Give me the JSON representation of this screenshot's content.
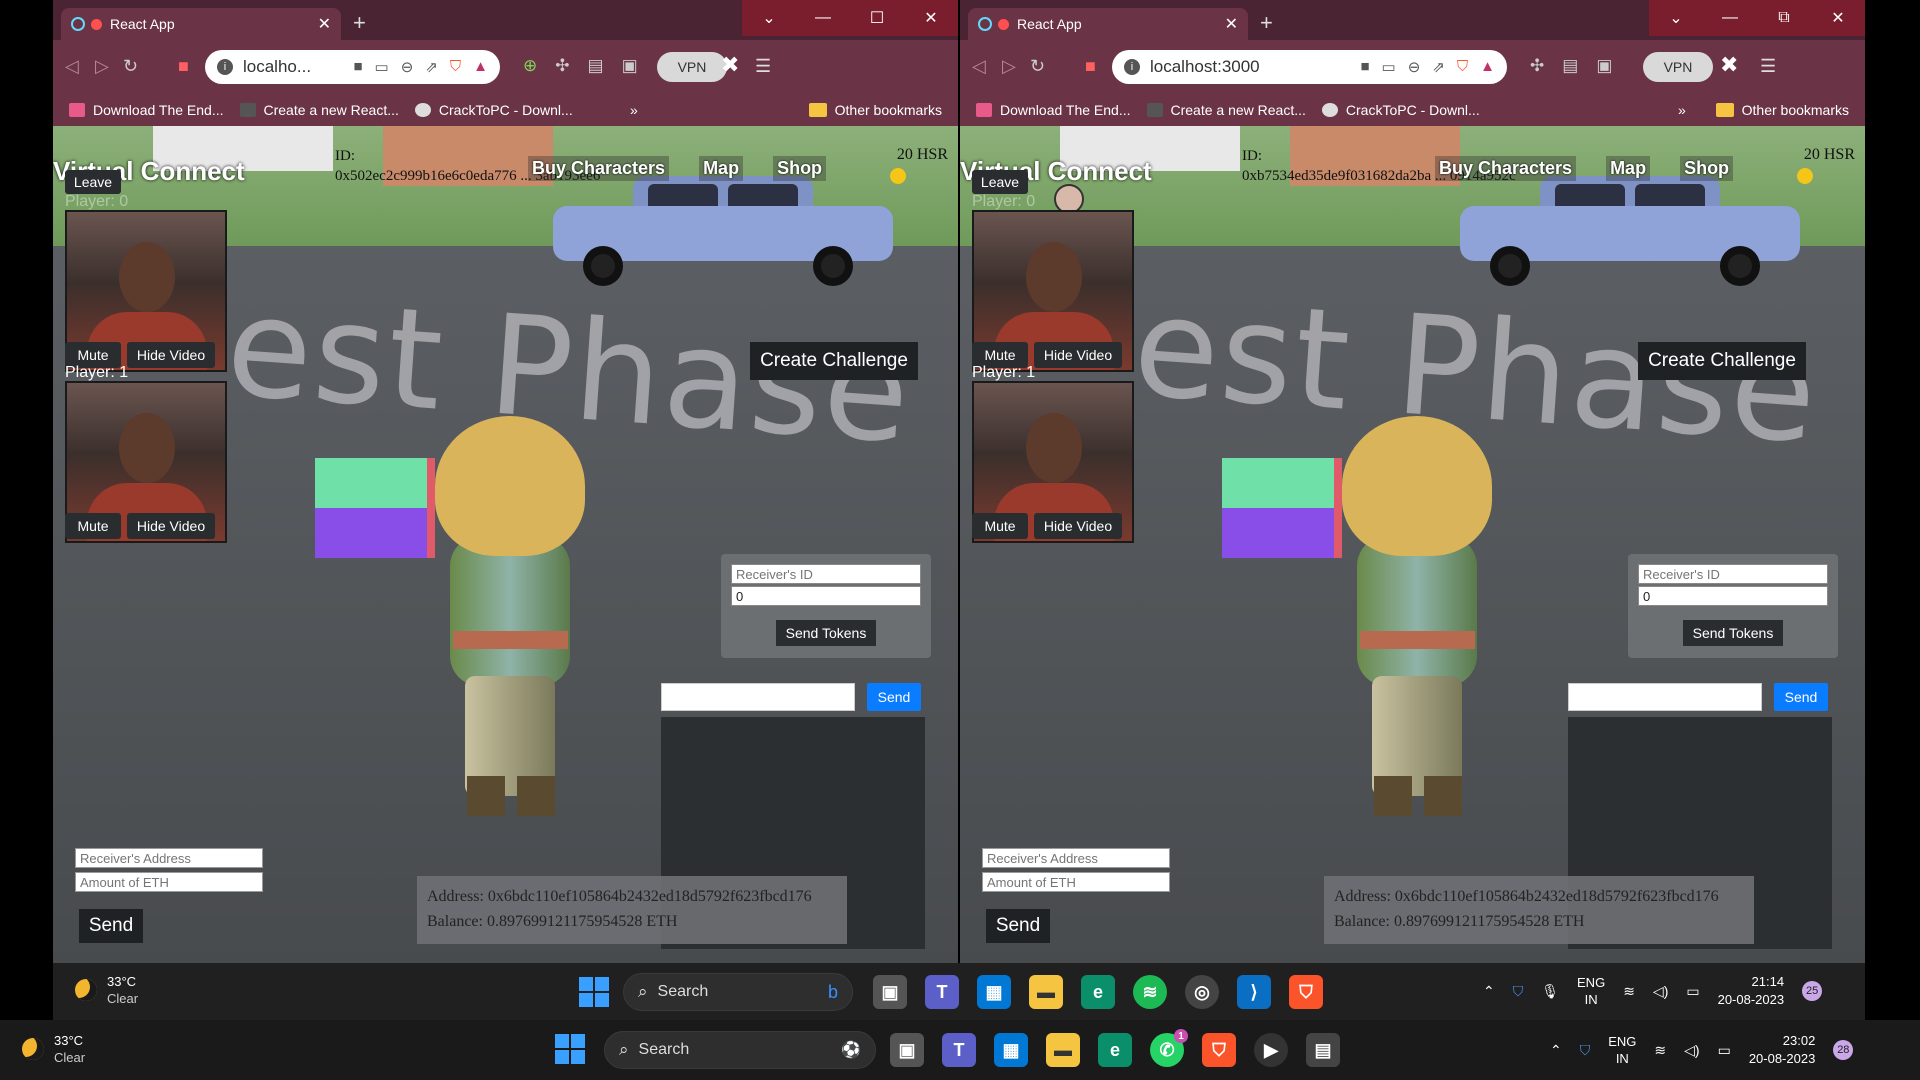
{
  "browser_left": {
    "tab_title": "React App",
    "url": "localho...",
    "vpn_label": "VPN",
    "bookmarks": [
      "Download The End...",
      "Create a new React...",
      "CrackToPC - Downl..."
    ],
    "other_bookmarks": "Other bookmarks",
    "app": {
      "title": "Virtual Connect",
      "id_label": "ID:",
      "id_value": "0x502ec2c999b16e6c0eda776 ... 3ab193ee6",
      "hsr": "20 HSR",
      "nav": [
        "Buy Characters",
        "Map",
        "Shop"
      ],
      "leave": "Leave",
      "player0": "Player: 0",
      "player1": "Player: 1",
      "mute": "Mute",
      "hide_video": "Hide Video",
      "watermark": "est Phase",
      "create_challenge": "Create Challenge",
      "receiver_id_placeholder": "Receiver's ID",
      "amount_value": "0",
      "send_tokens": "Send Tokens",
      "chat_send": "Send",
      "receiver_address_placeholder": "Receiver's Address",
      "amount_eth_placeholder": "Amount of ETH",
      "eth_send": "Send",
      "address": "Address: 0x6bdc110ef105864b2432ed18d5792f623fbcd176",
      "balance": "Balance: 0.897699121175954528 ETH"
    }
  },
  "browser_right": {
    "tab_title": "React App",
    "url": "localhost:3000",
    "vpn_label": "VPN",
    "bookmarks": [
      "Download The End...",
      "Create a new React...",
      "CrackToPC - Downl..."
    ],
    "other_bookmarks": "Other bookmarks",
    "app": {
      "title": "Virtual Connect",
      "id_label": "ID:",
      "id_value": "0xb7534ed35de9f031682da2ba ... 0914a952c",
      "hsr": "20 HSR",
      "nav": [
        "Buy Characters",
        "Map",
        "Shop"
      ],
      "leave": "Leave",
      "player0": "Player: 0",
      "player1": "Player: 1",
      "mute": "Mute",
      "hide_video": "Hide Video",
      "watermark": "est Phase",
      "create_challenge": "Create Challenge",
      "receiver_id_placeholder": "Receiver's ID",
      "amount_value": "0",
      "send_tokens": "Send Tokens",
      "chat_send": "Send",
      "receiver_address_placeholder": "Receiver's Address",
      "amount_eth_placeholder": "Amount of ETH",
      "eth_send": "Send",
      "address": "Address: 0x6bdc110ef105864b2432ed18d5792f623fbcd176",
      "balance": "Balance: 0.897699121175954528 ETH"
    }
  },
  "taskbar_inner": {
    "temp": "33°C",
    "condition": "Clear",
    "search": "Search",
    "lang1": "ENG",
    "lang2": "IN",
    "time": "21:14",
    "date": "20-08-2023",
    "notif_count": "25"
  },
  "taskbar_outer": {
    "temp": "33°C",
    "condition": "Clear",
    "search": "Search",
    "lang1": "ENG",
    "lang2": "IN",
    "time": "23:02",
    "date": "20-08-2023",
    "notif_count": "28",
    "whatsapp_badge": "1"
  },
  "colors": {
    "browser_frame": "#6b3446",
    "chat_send": "#0a7cff",
    "coin": "#f5c518"
  }
}
